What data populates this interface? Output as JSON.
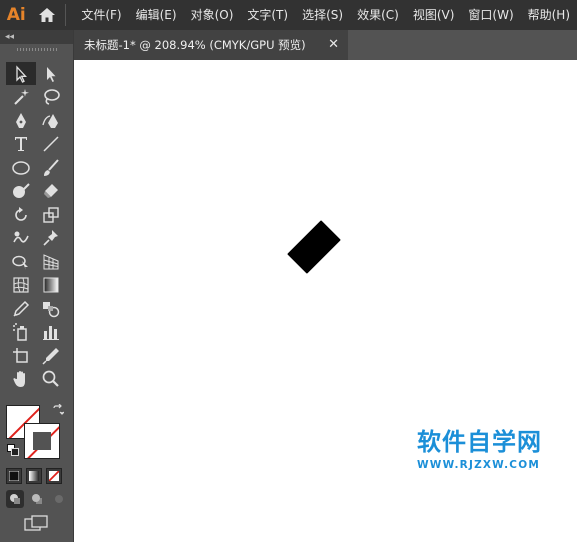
{
  "app": {
    "logo_text": "Ai"
  },
  "menu": {
    "items": [
      "文件(F)",
      "编辑(E)",
      "对象(O)",
      "文字(T)",
      "选择(S)",
      "效果(C)",
      "视图(V)",
      "窗口(W)",
      "帮助(H)"
    ]
  },
  "panel": {
    "collapse_label": "◂◂"
  },
  "document": {
    "tab_title": "未标题-1* @ 208.94% (CMYK/GPU 预览)",
    "close_glyph": "✕"
  },
  "colors": {
    "accent": "#e6842a",
    "canvas": "#ffffff",
    "shape_fill": "#000000",
    "none_slash": "#e0221c",
    "watermark": "#1b8fd8"
  },
  "watermark": {
    "title": "软件自学网",
    "url": "WWW.RJZXW.COM"
  }
}
